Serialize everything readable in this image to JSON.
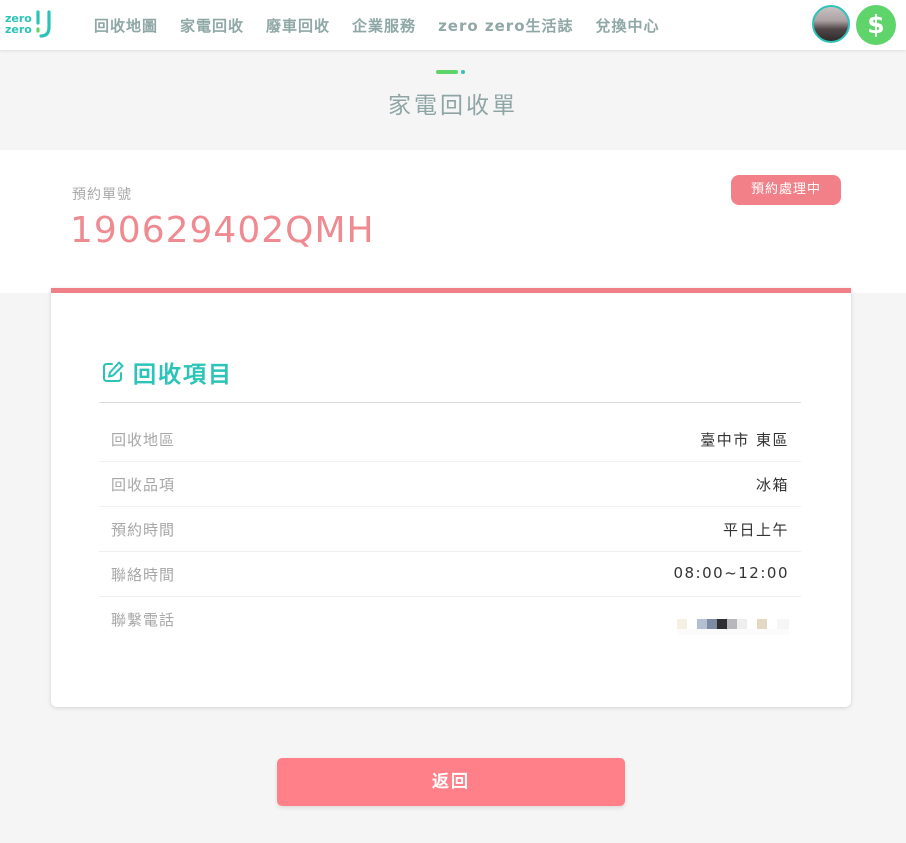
{
  "logo": {
    "line1": "zero",
    "line2": "zero"
  },
  "nav": {
    "items": [
      {
        "label": "回收地圖"
      },
      {
        "label": "家電回收"
      },
      {
        "label": "廢車回收"
      },
      {
        "label": "企業服務"
      },
      {
        "label": "zero zero生活誌"
      },
      {
        "label": "兌換中心"
      }
    ]
  },
  "header": {
    "coin_symbol": "$"
  },
  "page": {
    "title": "家電回收單"
  },
  "order": {
    "label": "預約單號",
    "number": "190629402QMH",
    "status": "預約處理中"
  },
  "details": {
    "title": "回收項目",
    "icon": "edit-icon",
    "rows": [
      {
        "label": "回收地區",
        "value": "臺中市 東區"
      },
      {
        "label": "回收品項",
        "value": "冰箱"
      },
      {
        "label": "預約時間",
        "value": "平日上午"
      },
      {
        "label": "聯絡時間",
        "value": "08:00~12:00"
      },
      {
        "label": "聯繫電話",
        "value": ""
      }
    ]
  },
  "actions": {
    "back_label": "返回"
  },
  "colors": {
    "teal": "#2cc3b8",
    "pink": "#ef8a91",
    "button_pink": "#ff8088",
    "coin_green": "#5ed46b"
  }
}
